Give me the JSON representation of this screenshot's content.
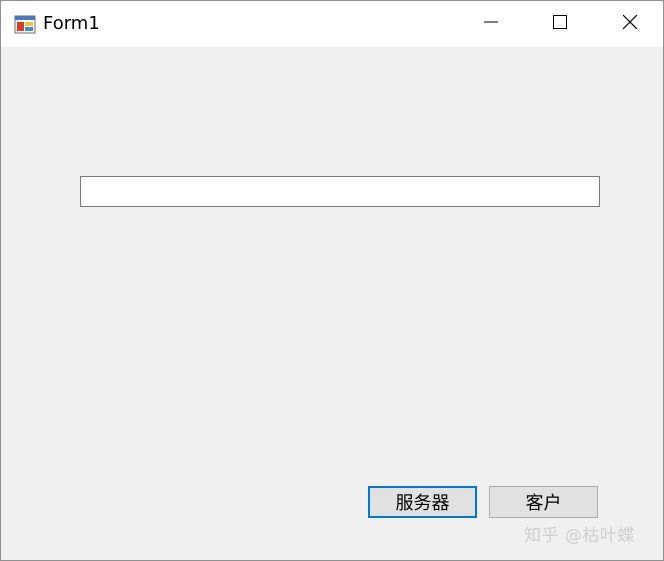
{
  "window": {
    "title": "Form1",
    "icon": "winforms-app-icon"
  },
  "titlebar_controls": {
    "minimize": "minimize-icon",
    "maximize": "maximize-icon",
    "close": "close-icon"
  },
  "main": {
    "textbox_value": "",
    "server_button_label": "服务器",
    "client_button_label": "客户"
  },
  "watermark": {
    "text": "知乎 @枯叶蝶"
  },
  "colors": {
    "window_bg": "#f0f0f0",
    "focus_accent": "#0078d7"
  }
}
